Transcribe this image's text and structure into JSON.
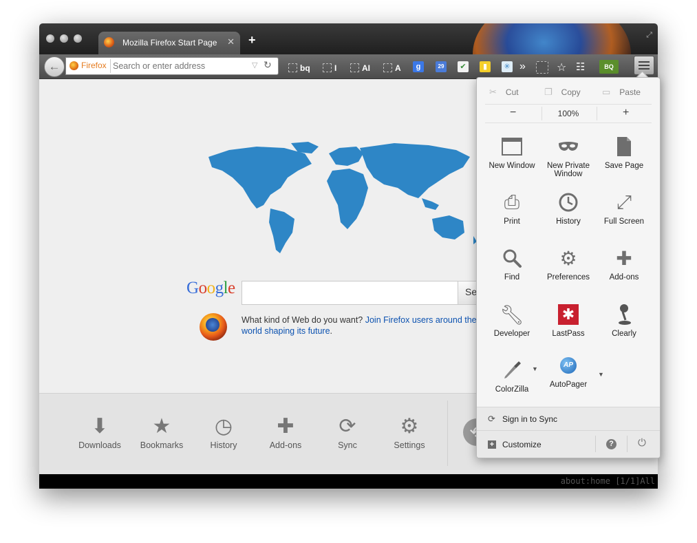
{
  "tabs": [
    {
      "title": "Mozilla Firefox Start Page"
    }
  ],
  "navbar": {
    "identity": "Firefox",
    "url_placeholder": "Search or enter address",
    "bookmarks": [
      "bq",
      "I",
      "AI",
      "A"
    ]
  },
  "start_page": {
    "search_button": "Search",
    "snippet_text": "What kind of Web do you want? ",
    "snippet_link": "Join Firefox users around the world shaping its future",
    "snippet_end": ".",
    "launcher": [
      {
        "label": "Downloads",
        "icon": "download-icon"
      },
      {
        "label": "Bookmarks",
        "icon": "star-icon"
      },
      {
        "label": "History",
        "icon": "clock-icon"
      },
      {
        "label": "Add-ons",
        "icon": "puzzle-icon"
      },
      {
        "label": "Sync",
        "icon": "sync-icon"
      },
      {
        "label": "Settings",
        "icon": "gear-icon"
      }
    ]
  },
  "menu_panel": {
    "edit": {
      "cut": "Cut",
      "copy": "Copy",
      "paste": "Paste"
    },
    "zoom": {
      "minus": "−",
      "value": "100%",
      "plus": "+"
    },
    "items": [
      {
        "label": "New Window",
        "icon": "window-icon"
      },
      {
        "label": "New Private Window",
        "icon": "mask-icon"
      },
      {
        "label": "Save Page",
        "icon": "page-icon"
      },
      {
        "label": "Print",
        "icon": "printer-icon"
      },
      {
        "label": "History",
        "icon": "clock-icon"
      },
      {
        "label": "Full Screen",
        "icon": "fullscreen-icon"
      },
      {
        "label": "Find",
        "icon": "magnifier-icon"
      },
      {
        "label": "Preferences",
        "icon": "gear-icon"
      },
      {
        "label": "Add-ons",
        "icon": "puzzle-icon"
      },
      {
        "label": "Developer",
        "icon": "wrench-icon"
      },
      {
        "label": "LastPass",
        "icon": "lastpass-icon"
      },
      {
        "label": "Clearly",
        "icon": "lamp-icon"
      },
      {
        "label": "ColorZilla",
        "icon": "eyedropper-icon"
      },
      {
        "label": "AutoPager",
        "icon": "autopager-icon"
      }
    ],
    "sync": "Sign in to Sync",
    "customize": "Customize"
  },
  "statusbar": {
    "text": "about:home [1/1]All"
  },
  "colors": {
    "accent": "#e57b1e",
    "link": "#0c52b0",
    "map": "#2e86c6",
    "lastpass": "#c8202f"
  }
}
